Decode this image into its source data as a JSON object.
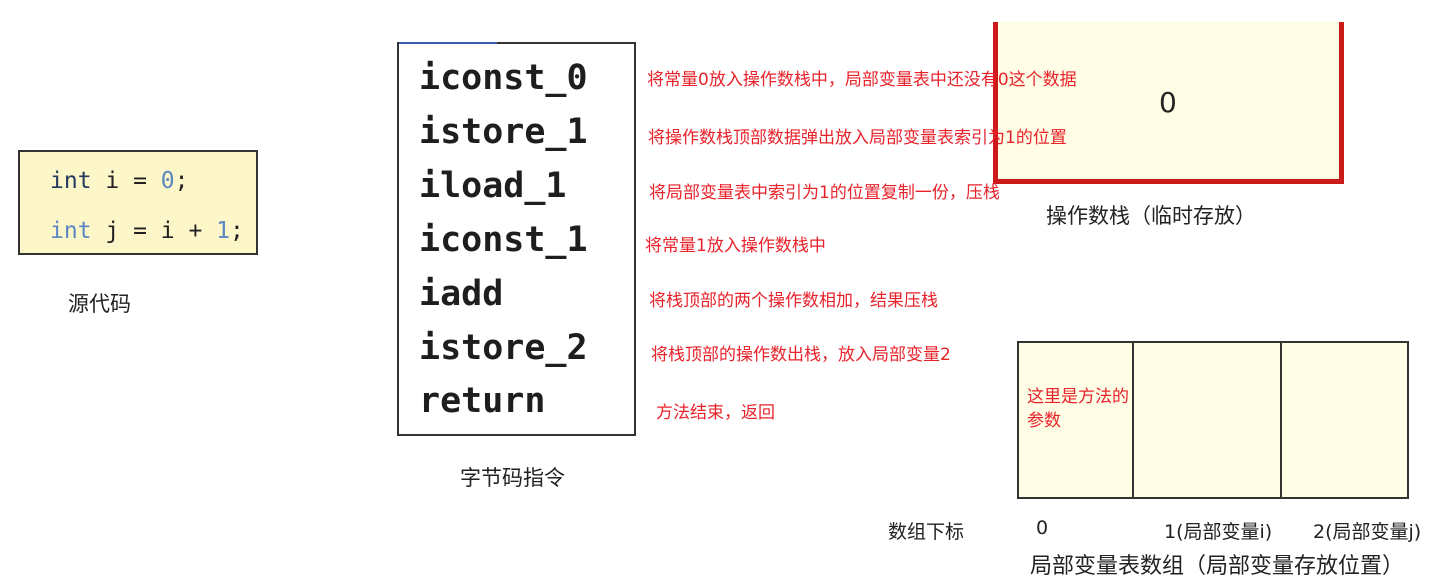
{
  "source": {
    "line1": {
      "kw": "int",
      "rest": " i = ",
      "num": "0",
      "end": ";"
    },
    "line2": {
      "kw": "int",
      "rest": " j = i + ",
      "num": "1",
      "end": ";"
    },
    "label": "源代码"
  },
  "bytecode": {
    "instructions": [
      "iconst_0",
      "istore_1",
      "iload_1",
      "iconst_1",
      "iadd",
      "istore_2",
      "return"
    ],
    "notes": [
      "将常量0放入操作数栈中，局部变量表中还没有0这个数据",
      "将操作数栈顶部数据弹出放入局部变量表索引为1的位置",
      "将局部变量表中索引为1的位置复制一份，压栈",
      "将常量1放入操作数栈中",
      "将栈顶部的两个操作数相加，结果压栈",
      "将栈顶部的操作数出栈，放入局部变量2",
      "方法结束，返回"
    ],
    "label": "字节码指令"
  },
  "stack": {
    "value": "0",
    "label": "操作数栈（临时存放）",
    "border_color": "#cc1a1a"
  },
  "local_vars": {
    "cell0_note": "这里是方法的参数",
    "index_label": "数组下标",
    "indices": [
      "0",
      "1(局部变量i)",
      "2(局部变量j)"
    ],
    "label": "局部变量表数组（局部变量存放位置）"
  },
  "colors": {
    "note": "#e8222a",
    "code_bg": "#fdf6c8",
    "box_bg": "#fffde6"
  }
}
